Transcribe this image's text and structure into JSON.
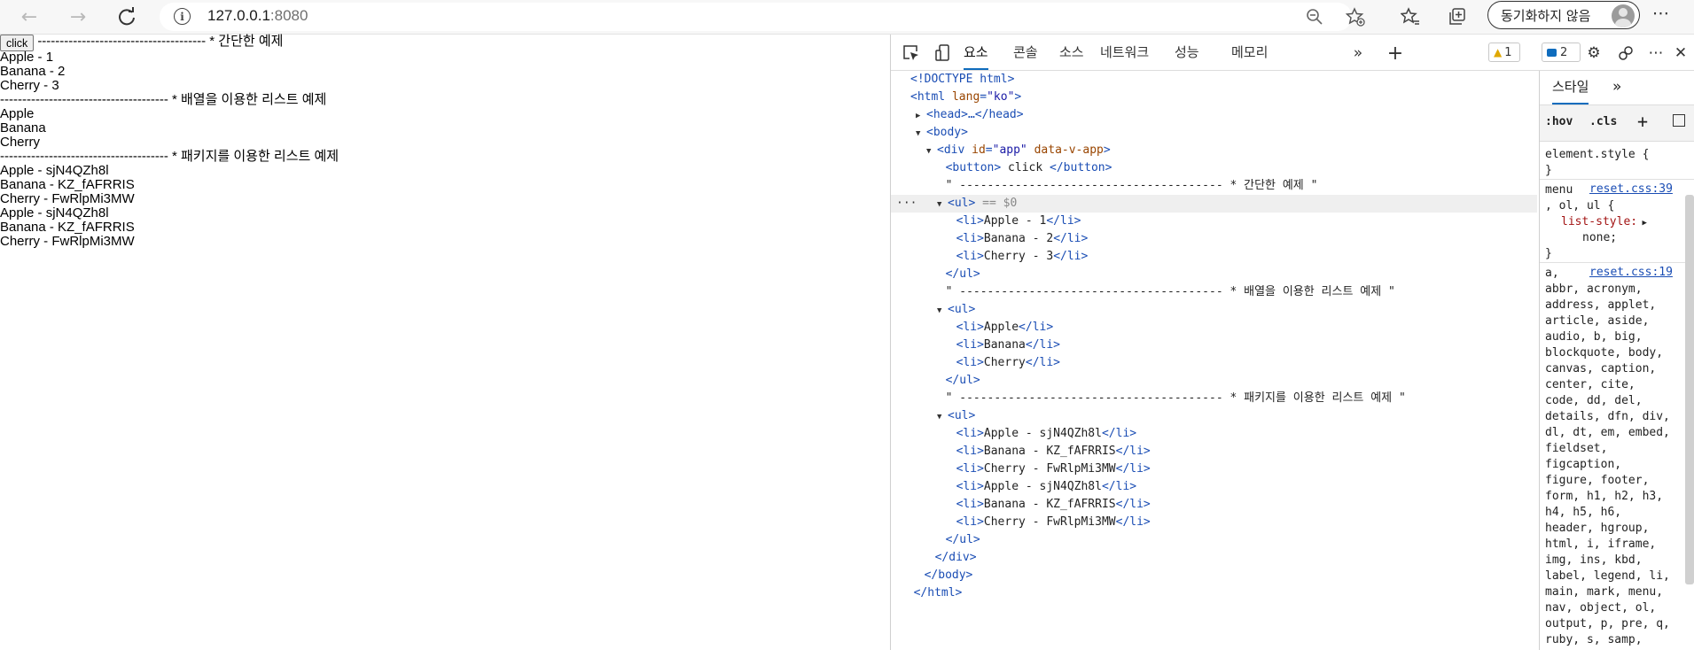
{
  "browser": {
    "url_host": "127.0.0.1",
    "url_port": ":8080",
    "sync_label": "동기화하지 않음"
  },
  "page": {
    "button_label": "click",
    "line1": "-------------------------------------- * 간단한 예제",
    "list1": [
      "Apple - 1",
      "Banana - 2",
      "Cherry - 3"
    ],
    "line2": "-------------------------------------- * 배열을 이용한 리스트 예제",
    "list2": [
      "Apple",
      "Banana",
      "Cherry"
    ],
    "line3": "-------------------------------------- * 패키지를 이용한 리스트 예제",
    "list3": [
      "Apple - sjN4QZh8l",
      "Banana - KZ_fAFRRIS",
      "Cherry - FwRlpMi3MW",
      "Apple - sjN4QZh8l",
      "Banana - KZ_fAFRRIS",
      "Cherry - FwRlpMi3MW"
    ]
  },
  "devtools": {
    "tabs": [
      "요소",
      "콘솔",
      "소스",
      "네트워크",
      "성능",
      "메모리"
    ],
    "active_tab": "요소",
    "warn_count": "1",
    "msg_count": "2",
    "dom": {
      "doctype": "<!DOCTYPE html>",
      "html_open_tag": "<html",
      "html_lang_attr": "lang",
      "html_lang_val": "\"ko\"",
      "head": "<head>…</head>",
      "body_open": "<body>",
      "div_open_tag": "<div",
      "div_id_attr": "id",
      "div_id_val": "\"app\"",
      "div_extra_attr": "data-v-app",
      "button_line_open": "<button>",
      "button_line_text": " click ",
      "button_line_close": "</button>",
      "text1": "\" -------------------------------------- * 간단한 예제 \"",
      "ul_open": "<ul>",
      "selected_marker": "== $0",
      "ul1_items": [
        "Apple - 1",
        "Banana - 2",
        "Cherry - 3"
      ],
      "ul_close": "</ul>",
      "text2": "\" -------------------------------------- * 배열을 이용한 리스트 예제 \"",
      "ul2_items": [
        "Apple",
        "Banana",
        "Cherry"
      ],
      "text3": "\" -------------------------------------- * 패키지를 이용한 리스트 예제 \"",
      "ul3_items": [
        "Apple - sjN4QZh8l",
        "Banana - KZ_fAFRRIS",
        "Cherry - FwRlpMi3MW",
        "Apple - sjN4QZh8l",
        "Banana - KZ_fAFRRIS",
        "Cherry - FwRlpMi3MW"
      ],
      "li_open": "<li>",
      "li_close": "</li>",
      "div_close": "</div>",
      "body_close": "</body>",
      "html_close": "</html>"
    },
    "styles": {
      "tab_label": "스타일",
      "more": "»",
      "hov": ":hov",
      "cls": ".cls",
      "element_style": "element.style {",
      "close_brace": "}",
      "rule1_sel1": "menu",
      "rule1_sel2": ", ol, ul {",
      "rule1_src": "reset.css:39",
      "rule1_prop": "list-style:",
      "rule1_val": "none;",
      "rule2_src": "reset.css:19",
      "rule2_lines": [
        "a,",
        "abbr, acronym,",
        "address, applet,",
        "article, aside,",
        "audio, b, big,",
        "blockquote, body,",
        "canvas, caption,",
        "center, cite,",
        "code, dd, del,",
        "details, dfn, div,",
        "dl, dt, em, embed,",
        "fieldset,",
        "figcaption,",
        "figure, footer,",
        "form, h1, h2, h3,",
        "h4, h5, h6,",
        "header, hgroup,",
        "html, i, iframe,",
        "img, ins, kbd,",
        "label, legend, li,",
        "main, mark, menu,",
        "nav, object, ol,",
        "output, p, pre, q,",
        "ruby, s, samp,"
      ]
    }
  }
}
